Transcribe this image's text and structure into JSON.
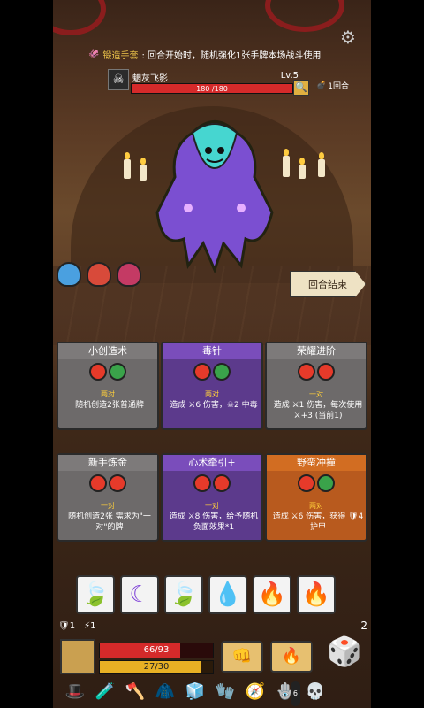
{
  "banner": {
    "keyword": "锻造手套",
    "text": ": 回合开始时，随机强化1张手牌本场战斗使用"
  },
  "settings_icon": "gear-icon",
  "enemy": {
    "name": "魍灰飞影",
    "level": "Lv.5",
    "hp": "180 /180",
    "hp_fraction": 1.0
  },
  "round": {
    "label": "1回合"
  },
  "end_turn": {
    "label": "回合结束"
  },
  "cards": [
    {
      "title": "小创造术",
      "pair": "两对",
      "desc": "随机创造2张普通牌",
      "color": "grey",
      "orbs": [
        "red",
        "green"
      ]
    },
    {
      "title": "毒针",
      "pair": "两对",
      "desc": "造成 ⚔6 伤害，☠2 中毒",
      "color": "purple",
      "orbs": [
        "red",
        "green"
      ]
    },
    {
      "title": "荣耀进阶",
      "pair": "一对",
      "desc": "造成 ⚔1 伤害，每次使用 ⚔+3 (当前1)",
      "color": "grey",
      "orbs": [
        "red",
        "red"
      ]
    },
    {
      "title": "新手炼金",
      "pair": "一对",
      "desc": "随机创造2张 需求为\"一对\"的牌",
      "color": "grey",
      "orbs": [
        "red",
        "red"
      ]
    },
    {
      "title": "心术牵引+",
      "pair": "一对",
      "desc": "造成 ⚔8 伤害，给予随机负面效果*1",
      "color": "purple",
      "orbs": [
        "red",
        "red"
      ]
    },
    {
      "title": "野蛮冲撞",
      "pair": "两对",
      "desc": "造成 ⚔6 伤害，获得 🛡4 护甲",
      "color": "orange",
      "orbs": [
        "red",
        "green"
      ]
    }
  ],
  "hand": [
    "🍃",
    "☾",
    "🍃",
    "💧",
    "🔥",
    "🔥"
  ],
  "status": {
    "shield": "1",
    "energy_small": "1"
  },
  "player": {
    "hp": "66/93",
    "hp_fraction": 0.71,
    "energy": "27/30",
    "energy_fraction": 0.9
  },
  "dice_count": "2",
  "relics": [
    {
      "icon": "🎩"
    },
    {
      "icon": "🧪"
    },
    {
      "icon": "🪓"
    },
    {
      "icon": "🧥"
    },
    {
      "icon": "🧊"
    },
    {
      "icon": "🧤"
    },
    {
      "icon": "🧭"
    },
    {
      "icon": "🪬",
      "badge": "6"
    },
    {
      "icon": "💀"
    }
  ]
}
